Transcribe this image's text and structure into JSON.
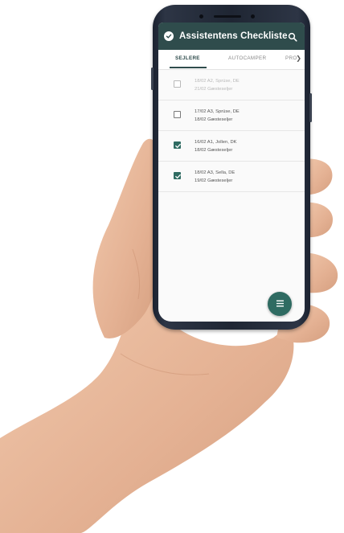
{
  "app": {
    "title": "Assistentens Checkliste",
    "icons": {
      "app": "check-circle-icon",
      "search": "search-icon",
      "menu": "menu-icon",
      "tabs_next": "chevron-right-icon"
    }
  },
  "tabs": [
    {
      "label": "SEJLERE",
      "active": true
    },
    {
      "label": "AUTOCAMPER",
      "active": false
    },
    {
      "label": "PRO",
      "active": false
    }
  ],
  "list": [
    {
      "line1": "18/02 A2, Sprüse, DE",
      "line2": "21/02 Gæsteseljer",
      "checked": false,
      "dimmed": true
    },
    {
      "line1": "17/02 A3, Sprüse, DE",
      "line2": "18/02 Gæsteseljer",
      "checked": false,
      "dimmed": false
    },
    {
      "line1": "16/02 A1, Jollen, DK",
      "line2": "18/02 Gæsteseljer",
      "checked": true,
      "dimmed": false
    },
    {
      "line1": "18/02 A3, Sella, DE",
      "line2": "19/02 Gæsteseljer",
      "checked": true,
      "dimmed": false
    }
  ],
  "colors": {
    "primary": "#2f4c4c",
    "accent": "#2f6b62",
    "phone": "#1f2633"
  }
}
